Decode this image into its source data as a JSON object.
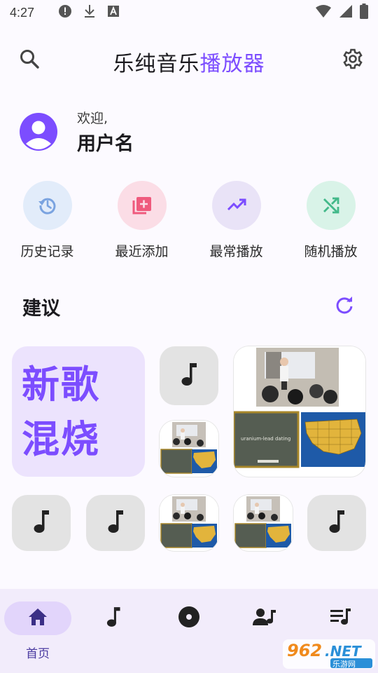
{
  "status_bar": {
    "time": "4:27",
    "left_icons": [
      "alert-circle-icon",
      "download-icon",
      "font-a-icon"
    ],
    "right_icons": [
      "wifi-icon",
      "cellular-signal-icon",
      "battery-icon"
    ]
  },
  "app_bar": {
    "title_part1": "乐纯音乐",
    "title_part2": "播放器",
    "search_icon": "search-icon",
    "settings_icon": "gear-icon"
  },
  "welcome": {
    "greeting": "欢迎,",
    "username": "用户名",
    "avatar_icon": "account-circle-icon"
  },
  "quick_actions": [
    {
      "label": "历史记录",
      "icon": "history-icon",
      "bg": "#e2ecfa",
      "fg": "#7aa3e0"
    },
    {
      "label": "最近添加",
      "icon": "library-add-icon",
      "bg": "#fbdde6",
      "fg": "#ef5a7d"
    },
    {
      "label": "最常播放",
      "icon": "trending-up-icon",
      "bg": "#e9e3f7",
      "fg": "#7c4dff"
    },
    {
      "label": "随机播放",
      "icon": "shuffle-icon",
      "bg": "#d9f3e8",
      "fg": "#43b98a"
    }
  ],
  "suggestions": {
    "title": "建议",
    "refresh_icon": "refresh-icon",
    "mix_line1": "新歌",
    "mix_line2": "混烧",
    "slide_text": "uranium-lead dating"
  },
  "bottom_nav": {
    "items": [
      {
        "label": "首页",
        "icon": "home-icon",
        "active": true
      },
      {
        "label": "",
        "icon": "music-note-icon",
        "active": false
      },
      {
        "label": "",
        "icon": "album-icon",
        "active": false
      },
      {
        "label": "",
        "icon": "artist-icon",
        "active": false
      },
      {
        "label": "",
        "icon": "playlist-icon",
        "active": false
      }
    ]
  },
  "watermark": {
    "text1": "962",
    "text2": ".NET",
    "text3": "乐游网"
  },
  "colors": {
    "accent": "#7c4dff",
    "accent_light": "#ece3fd",
    "nav_bg": "#f2ecfb"
  }
}
